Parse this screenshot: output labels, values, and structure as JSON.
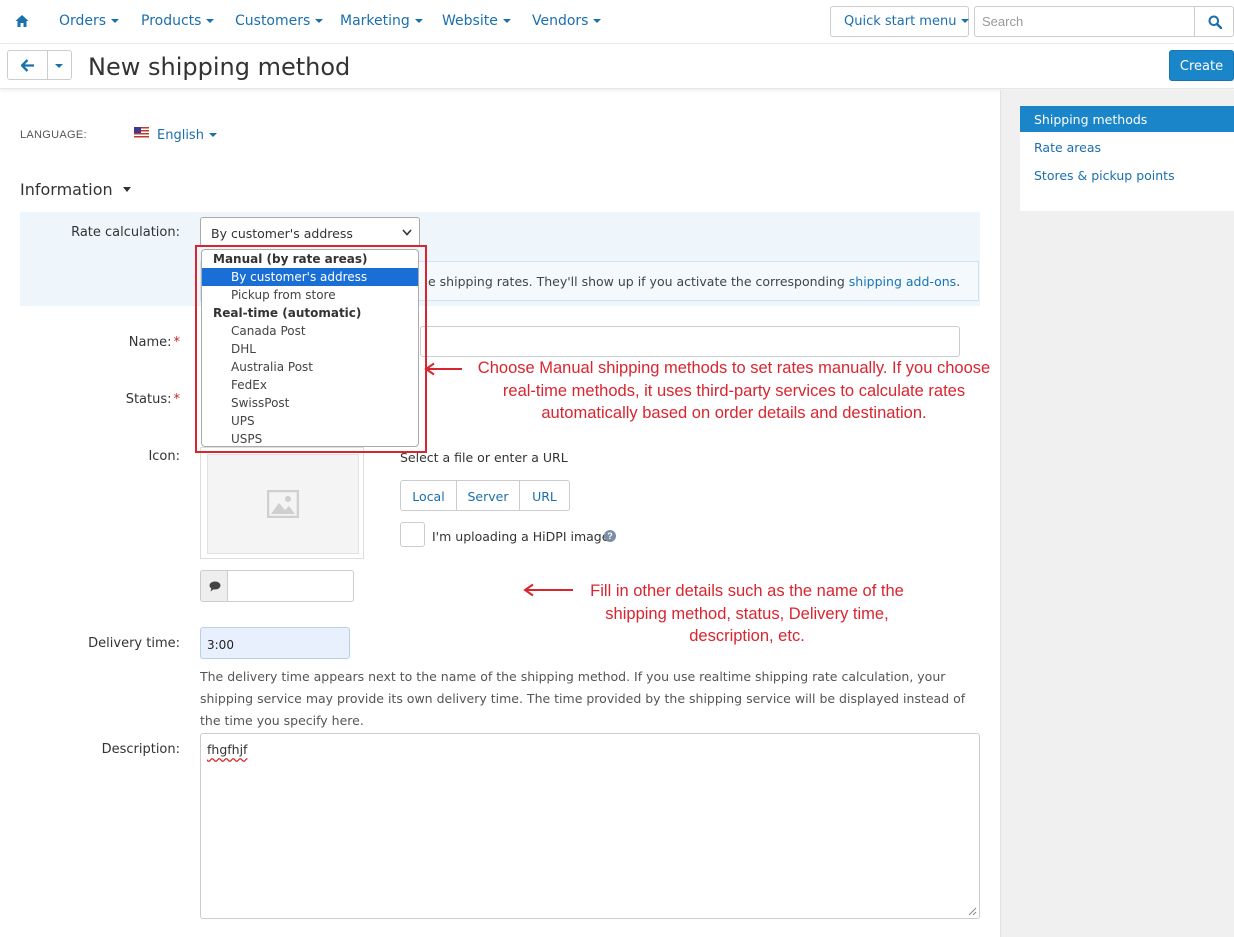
{
  "nav": {
    "items": [
      "Orders",
      "Products",
      "Customers",
      "Marketing",
      "Website",
      "Vendors"
    ],
    "quick_start": "Quick start menu",
    "search_placeholder": "Search"
  },
  "toolbar": {
    "title": "New shipping method",
    "create_label": "Create"
  },
  "sidebar": {
    "items": [
      "Shipping methods",
      "Rate areas",
      "Stores & pickup points"
    ],
    "active_index": 0
  },
  "language": {
    "label": "LANGUAGE:",
    "value": "English"
  },
  "section": {
    "title": "Information"
  },
  "form": {
    "rate_calc_label": "Rate calculation:",
    "rate_calc_value": "By customer's address",
    "info_note_text": "e shipping rates. They'll show up if you activate the corresponding ",
    "info_note_link": "shipping add-ons",
    "info_note_end": ".",
    "name_label": "Name:",
    "status_label": "Status:",
    "required_mark": "*",
    "icon_label": "Icon:",
    "select_file_label": "Select a file or enter a URL",
    "upload_tabs": [
      "Local",
      "Server",
      "URL"
    ],
    "hidpi_label": "I'm uploading a HiDPI image.",
    "delivery_label": "Delivery time:",
    "delivery_value": "3:00",
    "delivery_help": "The delivery time appears next to the name of the shipping method. If you use realtime shipping rate calculation, your shipping service may provide its own delivery time. The time provided by the shipping service will be displayed instead of the time you specify here.",
    "description_label": "Description:",
    "description_value": "fhgfhjf"
  },
  "dropdown": {
    "groups": [
      {
        "label": "Manual (by rate areas)",
        "options": [
          "By customer's address",
          "Pickup from store"
        ]
      },
      {
        "label": "Real-time (automatic)",
        "options": [
          "Canada Post",
          "DHL",
          "Australia Post",
          "FedEx",
          "SwissPost",
          "UPS",
          "USPS"
        ]
      }
    ],
    "selected": "By customer's address"
  },
  "annotations": {
    "callout1": [
      "Choose Manual shipping methods to set rates manually. If you choose",
      "real-time methods, it uses third-party services to calculate rates",
      "automatically based on order details and destination."
    ],
    "callout2": [
      "Fill in other details such as the name of the",
      "shipping method, status, Delivery time,",
      "description, etc."
    ],
    "color": "#d9252f"
  },
  "colors": {
    "link": "#1a6fad",
    "primary": "#1a85c8",
    "selected_option": "#1a6fd6",
    "sidebar_bg": "#f0f0f0",
    "rate_box_bg": "#eef6fb"
  }
}
